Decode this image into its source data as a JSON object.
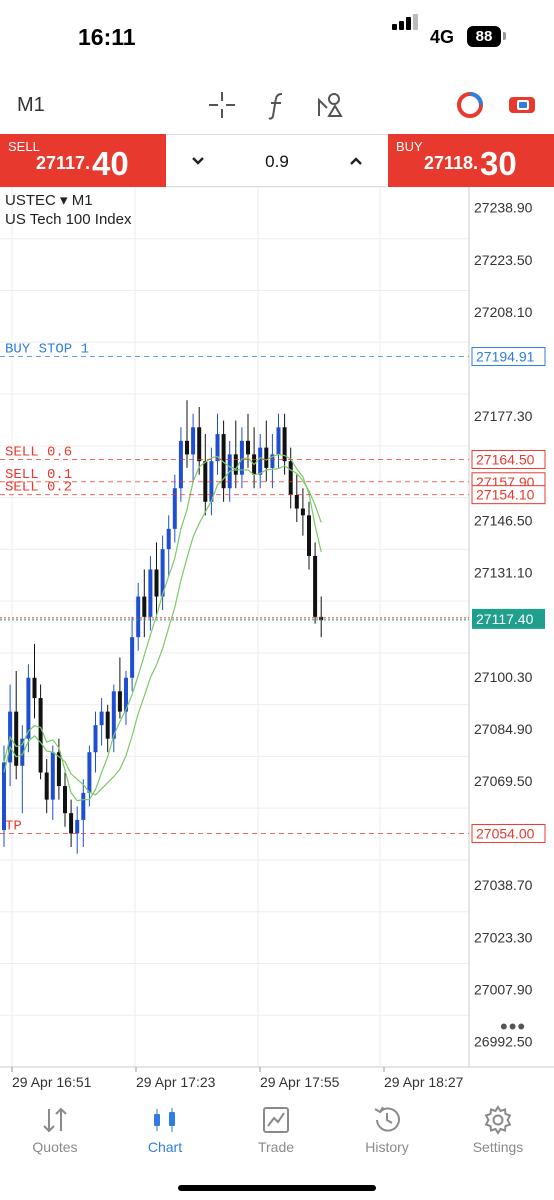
{
  "status_bar": {
    "time": "16:11",
    "network": "4G",
    "battery": "88"
  },
  "toolbar": {
    "timeframe": "M1",
    "icons": [
      "crosshair-icon",
      "function-icon",
      "drawing-tools-icon",
      "trade-toggle-icon",
      "quick-trade-icon"
    ],
    "accent_color": "#e8392e"
  },
  "trade_bar": {
    "sell_label": "SELL",
    "sell_price_main": "27117.",
    "sell_price_big": "40",
    "buy_label": "BUY",
    "buy_price_main": "27118.",
    "buy_price_big": "30",
    "volume": "0.9",
    "down_arrow": "˅",
    "up_arrow": "˄"
  },
  "chart": {
    "symbol": "USTEC ▾ M1",
    "symbol_desc": "US Tech 100 Index",
    "more": "•••"
  },
  "chart_data": {
    "type": "candlestick",
    "price_axis_labels": [
      "27238.90",
      "27223.50",
      "27208.10",
      "27177.30",
      "27146.50",
      "27131.10",
      "27100.30",
      "27084.90",
      "27069.50",
      "27038.70",
      "27023.30",
      "27007.90",
      "26992.50"
    ],
    "time_axis_labels": [
      "29 Apr 16:51",
      "29 Apr 17:23",
      "29 Apr 17:55",
      "29 Apr 18:27"
    ],
    "y_range": [
      26985,
      27245
    ],
    "order_lines": [
      {
        "label": "BUY STOP 1",
        "price": 27194.91,
        "tag": "27194.91",
        "color": "#2f7de1"
      },
      {
        "label": "SELL 0.6",
        "price": 27164.5,
        "tag": "27164.50",
        "color": "#e8392e"
      },
      {
        "label": "SELL 0.1",
        "price": 27157.9,
        "tag": "27157.90",
        "color": "#e8392e"
      },
      {
        "label": "SELL 0.2",
        "price": 27154.1,
        "tag": "27154.10",
        "color": "#e8392e"
      },
      {
        "label": "TP",
        "price": 27054.0,
        "tag": "27054.00",
        "color": "#e8392e"
      }
    ],
    "current_price": {
      "value": 27117.4,
      "tag": "27117.40",
      "color": "#1fa08d"
    },
    "bull_color": "#1f4fd0",
    "bear_color": "#111111",
    "ma_color": "#7cc867",
    "candles": [
      [
        27055,
        27080,
        27050,
        27075
      ],
      [
        27075,
        27098,
        27068,
        27090
      ],
      [
        27090,
        27102,
        27070,
        27074
      ],
      [
        27074,
        27086,
        27060,
        27082
      ],
      [
        27082,
        27104,
        27078,
        27100
      ],
      [
        27100,
        27110,
        27088,
        27094
      ],
      [
        27094,
        27098,
        27070,
        27072
      ],
      [
        27072,
        27076,
        27060,
        27064
      ],
      [
        27064,
        27080,
        27058,
        27078
      ],
      [
        27078,
        27082,
        27064,
        27068
      ],
      [
        27068,
        27072,
        27056,
        27060
      ],
      [
        27060,
        27064,
        27050,
        27054
      ],
      [
        27054,
        27062,
        27048,
        27058
      ],
      [
        27058,
        27070,
        27050,
        27066
      ],
      [
        27066,
        27080,
        27062,
        27078
      ],
      [
        27078,
        27090,
        27072,
        27086
      ],
      [
        27086,
        27094,
        27080,
        27090
      ],
      [
        27090,
        27092,
        27078,
        27082
      ],
      [
        27082,
        27098,
        27078,
        27096
      ],
      [
        27096,
        27106,
        27088,
        27090
      ],
      [
        27090,
        27102,
        27086,
        27100
      ],
      [
        27100,
        27118,
        27096,
        27112
      ],
      [
        27112,
        27128,
        27108,
        27124
      ],
      [
        27124,
        27132,
        27112,
        27118
      ],
      [
        27118,
        27136,
        27114,
        27132
      ],
      [
        27132,
        27140,
        27118,
        27124
      ],
      [
        27124,
        27142,
        27120,
        27138
      ],
      [
        27138,
        27148,
        27130,
        27144
      ],
      [
        27144,
        27160,
        27140,
        27156
      ],
      [
        27156,
        27174,
        27152,
        27170
      ],
      [
        27170,
        27182,
        27162,
        27166
      ],
      [
        27166,
        27178,
        27158,
        27174
      ],
      [
        27174,
        27180,
        27160,
        27164
      ],
      [
        27164,
        27172,
        27148,
        27152
      ],
      [
        27152,
        27168,
        27148,
        27164
      ],
      [
        27164,
        27178,
        27160,
        27172
      ],
      [
        27172,
        27176,
        27152,
        27156
      ],
      [
        27156,
        27170,
        27152,
        27166
      ],
      [
        27166,
        27176,
        27156,
        27160
      ],
      [
        27160,
        27174,
        27156,
        27170
      ],
      [
        27170,
        27178,
        27162,
        27166
      ],
      [
        27166,
        27174,
        27156,
        27160
      ],
      [
        27160,
        27172,
        27156,
        27168
      ],
      [
        27168,
        27176,
        27158,
        27162
      ],
      [
        27162,
        27172,
        27156,
        27166
      ],
      [
        27166,
        27178,
        27162,
        27174
      ],
      [
        27174,
        27178,
        27160,
        27164
      ],
      [
        27164,
        27168,
        27150,
        27154
      ],
      [
        27154,
        27160,
        27146,
        27150
      ],
      [
        27150,
        27156,
        27142,
        27148
      ],
      [
        27148,
        27152,
        27132,
        27136
      ],
      [
        27136,
        27140,
        27116,
        27118
      ],
      [
        27118,
        27124,
        27112,
        27117
      ]
    ]
  },
  "tabs": [
    {
      "label": "Quotes",
      "icon": "quotes-icon"
    },
    {
      "label": "Chart",
      "icon": "chart-icon",
      "active": true
    },
    {
      "label": "Trade",
      "icon": "trade-icon"
    },
    {
      "label": "History",
      "icon": "history-icon"
    },
    {
      "label": "Settings",
      "icon": "settings-icon"
    }
  ]
}
